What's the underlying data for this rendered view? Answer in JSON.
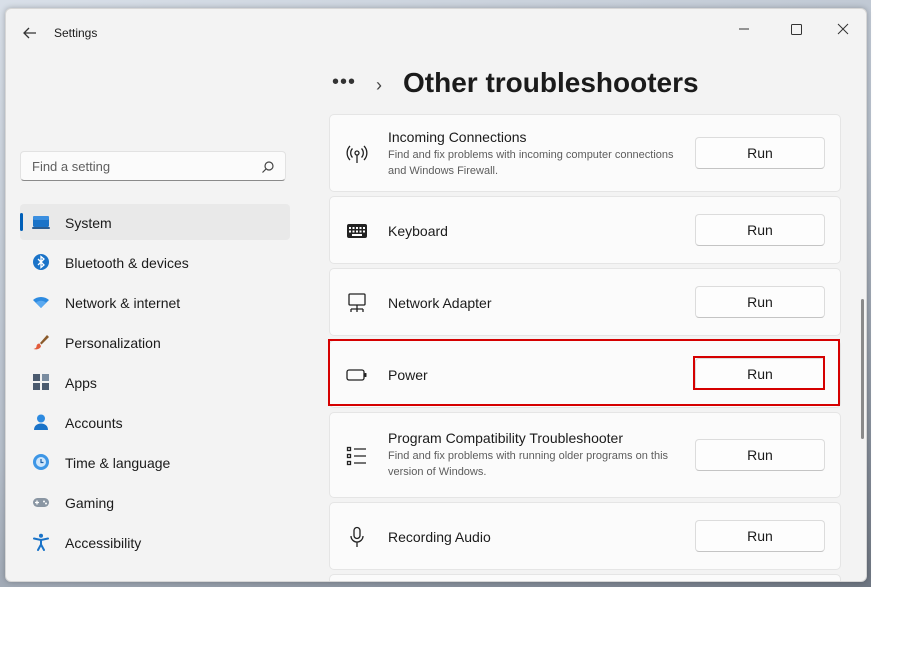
{
  "window": {
    "title": "Settings"
  },
  "search": {
    "placeholder": "Find a setting"
  },
  "nav": {
    "items": [
      {
        "label": "System",
        "icon": "laptop-icon",
        "active": true
      },
      {
        "label": "Bluetooth & devices",
        "icon": "bluetooth-icon"
      },
      {
        "label": "Network & internet",
        "icon": "wifi-icon"
      },
      {
        "label": "Personalization",
        "icon": "brush-icon"
      },
      {
        "label": "Apps",
        "icon": "apps-icon"
      },
      {
        "label": "Accounts",
        "icon": "person-icon"
      },
      {
        "label": "Time & language",
        "icon": "globe-clock-icon"
      },
      {
        "label": "Gaming",
        "icon": "gamepad-icon"
      },
      {
        "label": "Accessibility",
        "icon": "accessibility-icon"
      }
    ]
  },
  "breadcrumb": {
    "dots": "•••",
    "chevron": "›"
  },
  "page": {
    "title": "Other troubleshooters"
  },
  "troubleshooters": [
    {
      "title": "Incoming Connections",
      "desc": "Find and fix problems with incoming computer connections and Windows Firewall.",
      "button": "Run",
      "icon": "broadcast-icon"
    },
    {
      "title": "Keyboard",
      "desc": "",
      "button": "Run",
      "icon": "keyboard-icon"
    },
    {
      "title": "Network Adapter",
      "desc": "",
      "button": "Run",
      "icon": "network-adapter-icon"
    },
    {
      "title": "Power",
      "desc": "",
      "button": "Run",
      "icon": "battery-icon"
    },
    {
      "title": "Program Compatibility Troubleshooter",
      "desc": "Find and fix problems with running older programs on this version of Windows.",
      "button": "Run",
      "icon": "list-icon"
    },
    {
      "title": "Recording Audio",
      "desc": "",
      "button": "Run",
      "icon": "microphone-icon"
    }
  ],
  "colors": {
    "accent": "#005fb8",
    "highlight": "#d50000"
  }
}
